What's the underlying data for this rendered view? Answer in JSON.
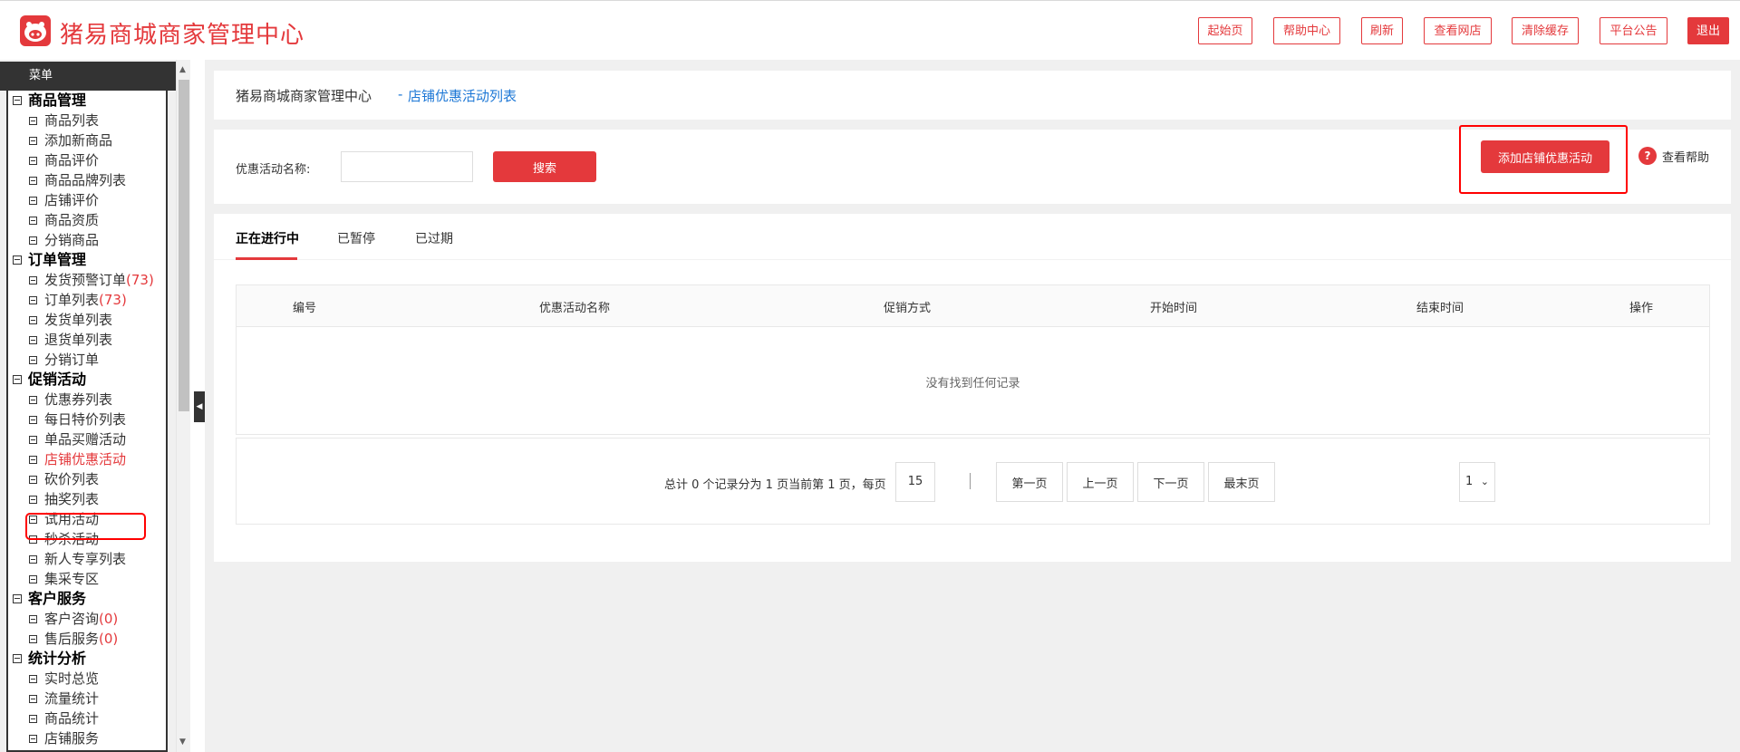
{
  "header": {
    "brand": "猪易商城商家管理中心",
    "buttons": {
      "home": "起始页",
      "help_center": "帮助中心",
      "refresh": "刷新",
      "view_store": "查看网店",
      "clear_cache": "清除缓存",
      "announcement": "平台公告",
      "logout": "退出"
    }
  },
  "sidebar": {
    "menu_title": "菜单",
    "groups": [
      {
        "label": "商品管理",
        "items": [
          "商品列表",
          "添加新商品",
          "商品评价",
          "商品品牌列表",
          "店铺评价",
          "商品资质",
          "分销商品"
        ]
      },
      {
        "label": "订单管理",
        "items": [
          "发货预警订单",
          "订单列表",
          "发货单列表",
          "退货单列表",
          "分销订单"
        ]
      },
      {
        "label": "促销活动",
        "items": [
          "优惠券列表",
          "每日特价列表",
          "单品买赠活动",
          "店铺优惠活动",
          "砍价列表",
          "抽奖列表",
          "试用活动",
          "秒杀活动",
          "新人专享列表",
          "集采专区"
        ]
      },
      {
        "label": "客户服务",
        "items": [
          "客户咨询",
          "售后服务"
        ]
      },
      {
        "label": "统计分析",
        "items": [
          "实时总览",
          "流量统计",
          "商品统计",
          "店铺服务"
        ]
      }
    ],
    "counts": {
      "warning_orders": "(73)",
      "orders": "(73)",
      "consult": "(0)",
      "after_sale": "(0)"
    }
  },
  "main": {
    "breadcrumb": {
      "root": "猪易商城商家管理中心",
      "separator": "-",
      "current": "店铺优惠活动列表"
    },
    "add_button": "添加店铺优惠活动",
    "help_icon": "?",
    "help_text": "查看帮助",
    "search": {
      "label": "优惠活动名称:",
      "value": "",
      "button": "搜索"
    },
    "tabs": [
      "正在进行中",
      "已暂停",
      "已过期"
    ],
    "table": {
      "columns": [
        "编号",
        "优惠活动名称",
        "促销方式",
        "开始时间",
        "结束时间",
        "操作"
      ],
      "empty_message": "没有找到任何记录"
    },
    "pager": {
      "summary": "总计 0 个记录分为 1 页当前第 1 页，每页",
      "per_page": "15",
      "first": "第一页",
      "prev": "上一页",
      "next": "下一页",
      "last": "最末页",
      "page_value": "1"
    }
  },
  "icons": {
    "logo": "pig-logo-icon",
    "help": "question-circle-icon",
    "collapse": "caret-left-icon",
    "scroll_up": "caret-up-icon",
    "scroll_down": "caret-down-icon",
    "dropdown": "chevron-down-icon",
    "tree_node": "square-minus-icon"
  },
  "colors": {
    "accent": "#e4393c",
    "link": "#1e78d6",
    "highlight": "#ff0000"
  }
}
